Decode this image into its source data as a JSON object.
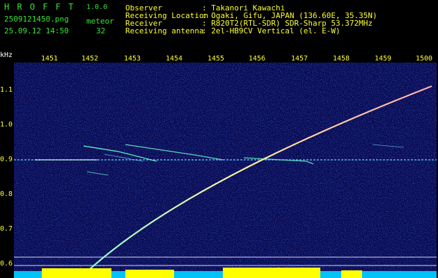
{
  "app": {
    "brand": "H R O F F T",
    "version": "1.0.0",
    "filename": "2509121450.png",
    "datetime": "25.09.12 14:50",
    "meteor_label": "meteor",
    "meteor_count": "32"
  },
  "info": [
    {
      "label": "Observer",
      "value": ": Takanori Kawachi"
    },
    {
      "label": "Receiving Location",
      "value": ": Ogaki, Gifu, JAPAN (136.60E, 35.35N)"
    },
    {
      "label": "Receiver",
      "value": ": R820T2(RTL-SDR) SDR-Sharp 53.372MHz"
    },
    {
      "label": "Receiving antenna",
      "value": ": 2el-HB9CV Vertical (el. E-W)"
    }
  ],
  "axis": {
    "unit": "kHz",
    "time_ticks": [
      "1451",
      "1452",
      "1453",
      "1454",
      "1455",
      "1456",
      "1457",
      "1458",
      "1459",
      "1500"
    ],
    "freq_ticks": [
      "1.1",
      "1.0",
      "0.9",
      "0.8",
      "0.7",
      "0.6"
    ]
  },
  "colors": {
    "background": "#000000",
    "spectrogram_bg": "#0a0a50",
    "noise": "#1e3cc8",
    "echo": "#66ffcc",
    "echo_core": "#ffff66",
    "carrier": "#66ccff",
    "level_cyan": "#00ccff",
    "level_yellow": "#ffff00",
    "label_yellow": "#ffff33",
    "label_green": "#33e833"
  }
}
